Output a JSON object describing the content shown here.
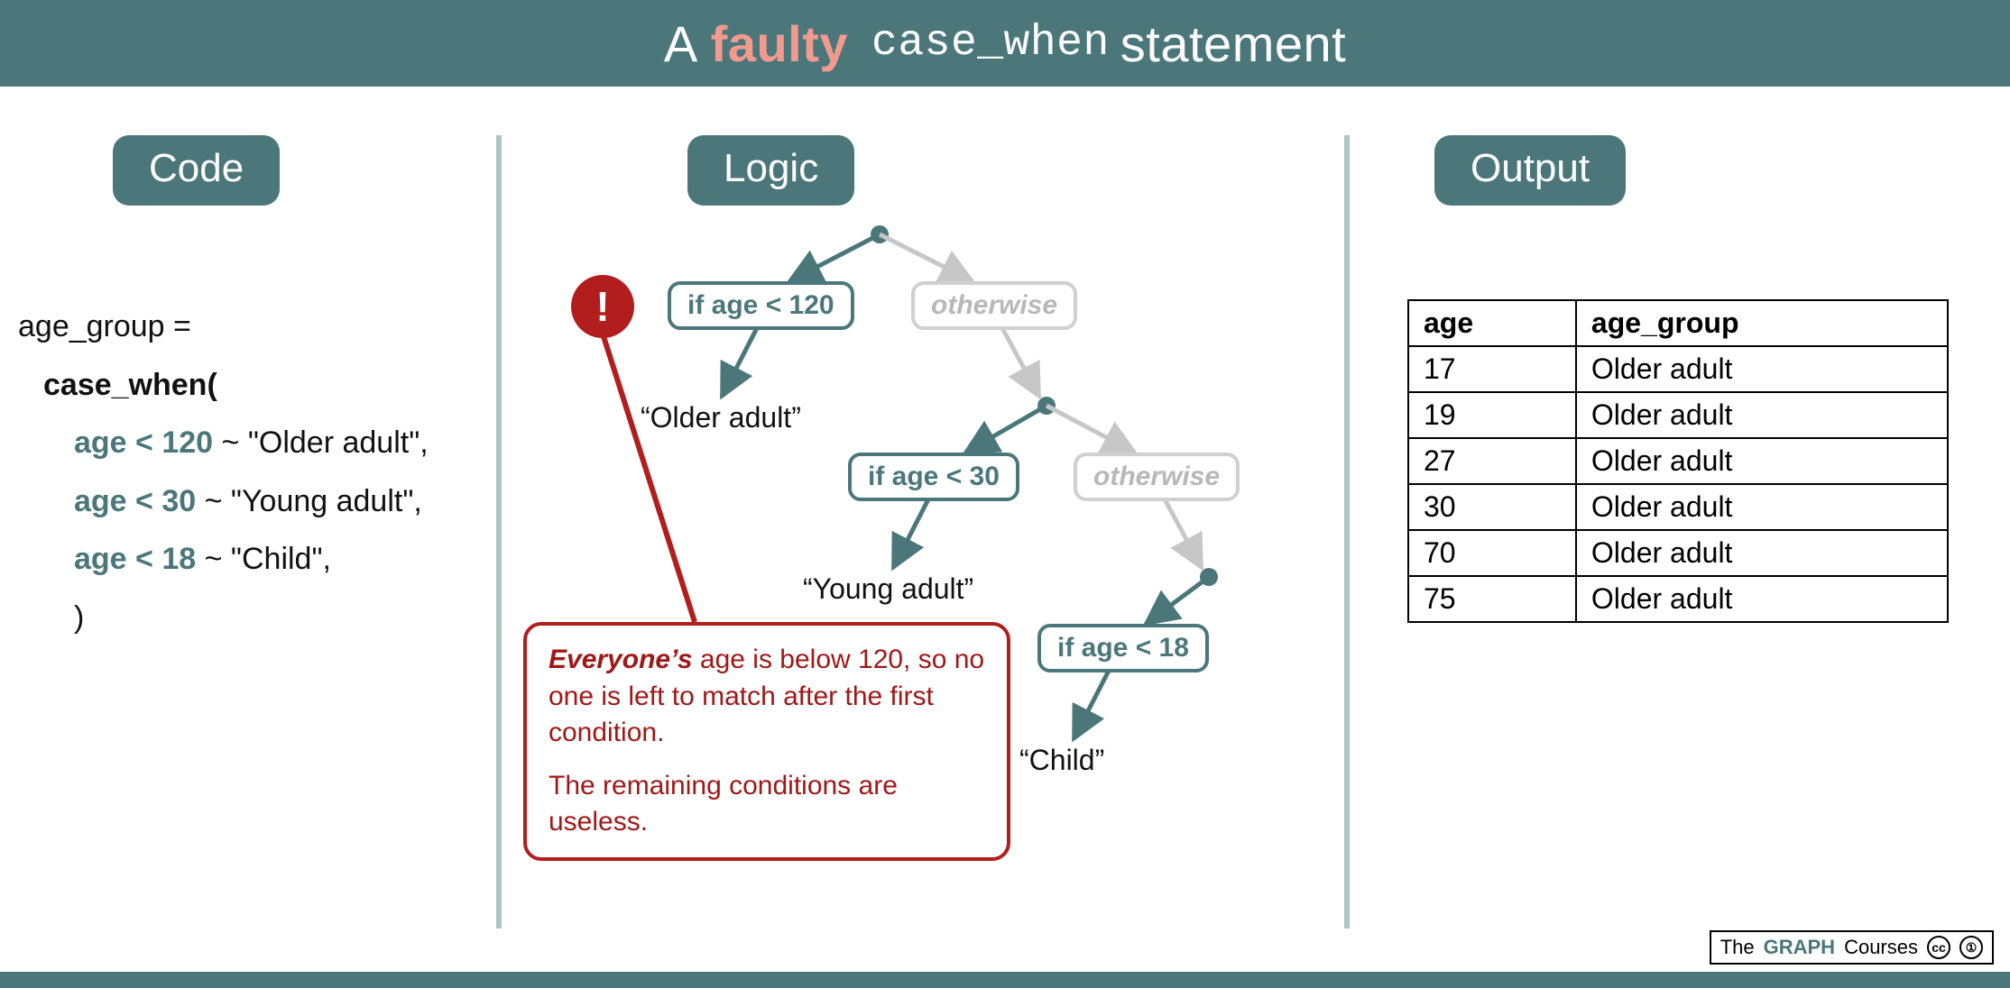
{
  "title": {
    "pre": "A",
    "faulty": "faulty",
    "cw": "case_when",
    "post": "statement"
  },
  "sections": {
    "code": "Code",
    "logic": "Logic",
    "output": "Output"
  },
  "code": {
    "assign": "age_group  =",
    "fn": "case_when(",
    "arms": [
      {
        "cond": "age < 120",
        "tilde": " ~ ",
        "value": "\"Older adult\","
      },
      {
        "cond": "age < 30",
        "tilde": " ~ ",
        "value": "\"Young adult\","
      },
      {
        "cond": "age < 18",
        "tilde": " ~ ",
        "value": "\"Child\","
      }
    ],
    "close": ")"
  },
  "logic": {
    "cond1": "if age < 120",
    "cond2": "if age < 30",
    "cond3": "if age < 18",
    "otherwise": "otherwise",
    "leaf1": "“Older adult”",
    "leaf2": "“Young adult”",
    "leaf3": "“Child”",
    "bang": "!",
    "callout_line1a": "Everyone’s",
    "callout_line1b": " age is below 120, so no one is left to match after the first condition.",
    "callout_line2": "The remaining conditions are useless."
  },
  "output": {
    "headers": [
      "age",
      "age_group"
    ],
    "rows": [
      [
        "17",
        "Older adult"
      ],
      [
        "19",
        "Older adult"
      ],
      [
        "27",
        "Older adult"
      ],
      [
        "30",
        "Older adult"
      ],
      [
        "70",
        "Older adult"
      ],
      [
        "75",
        "Older adult"
      ]
    ]
  },
  "attribution": {
    "pre": "The",
    "graph": "GRAPH",
    "post": "Courses"
  }
}
